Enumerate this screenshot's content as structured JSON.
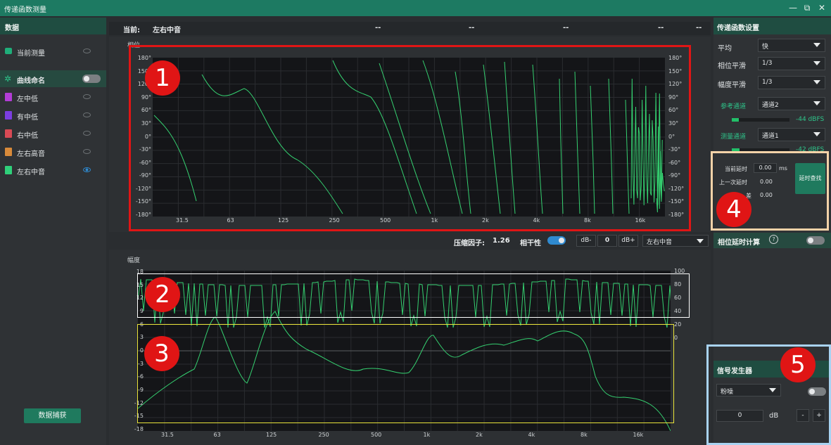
{
  "window": {
    "title": "传递函数测量",
    "controls": {
      "minimize": "—",
      "restore": "⧉",
      "close": "✕"
    }
  },
  "left_panel": {
    "header": "数据",
    "current_measurement": "当前测量",
    "curve_naming": "曲线命名",
    "curve_naming_enabled": false,
    "curves": [
      {
        "name": "左中低",
        "color": "#b33dd6",
        "visible": false
      },
      {
        "name": "有中低",
        "color": "#7b3ee0",
        "visible": false
      },
      {
        "name": "右中低",
        "color": "#d84a55",
        "visible": false
      },
      {
        "name": "左右高音",
        "color": "#d88a3a",
        "visible": false
      },
      {
        "name": "左右中音",
        "color": "#2fd07a",
        "visible": true
      }
    ],
    "capture_button": "数据捕获"
  },
  "current_bar": {
    "label": "当前:",
    "name": "左右中音",
    "values": [
      "--",
      "--",
      "--",
      "--",
      "--"
    ]
  },
  "phase_chart": {
    "section_label": "相位",
    "y_ticks": [
      "180°",
      "150°",
      "120°",
      "90°",
      "60°",
      "30°",
      "0°",
      "-30°",
      "-60°",
      "-90°",
      "-120°",
      "-150°",
      "-180°"
    ],
    "x_ticks": [
      "31.5",
      "63",
      "125",
      "250",
      "500",
      "1k",
      "2k",
      "4k",
      "8k",
      "16k"
    ]
  },
  "mid_bar": {
    "compression_label": "压缩因子:",
    "compression_value": "1.26",
    "coherence_label": "相干性",
    "coherence_enabled": true,
    "db_minus": "dB-",
    "db_value": "0",
    "db_plus": "dB+",
    "curve_select": "左右中音"
  },
  "magnitude_chart": {
    "section_label": "幅度",
    "y_ticks_left": [
      "18",
      "15",
      "12",
      "9",
      "6",
      "3",
      "0",
      "-3",
      "-6",
      "-9",
      "-12",
      "-15",
      "-18"
    ],
    "y_ticks_right": [
      "100",
      "80",
      "60",
      "40",
      "20",
      "0"
    ],
    "x_ticks": [
      "31.5",
      "63",
      "125",
      "250",
      "500",
      "1k",
      "2k",
      "4k",
      "8k",
      "16k"
    ]
  },
  "tf_settings": {
    "header": "传递函数设置",
    "average_label": "平均",
    "average_value": "快",
    "phase_smooth_label": "相位平滑",
    "phase_smooth_value": "1/3",
    "mag_smooth_label": "幅度平滑",
    "mag_smooth_value": "1/3",
    "ref_channel_label": "参考通道",
    "ref_channel_value": "通道2",
    "ref_level": "-44 dBFS",
    "ref_meter_fraction": 0.12,
    "meas_channel_label": "测量通道",
    "meas_channel_value": "通道1",
    "meas_level": "-42 dBFS",
    "meas_meter_fraction": 0.14
  },
  "delay": {
    "current_label": "当前延时",
    "current_value": "0.00",
    "current_unit": "ms",
    "last_label": "上一次延时",
    "last_value": "0.00",
    "third_label": "差",
    "third_value": "0.00",
    "find_button": "延时查找",
    "phase_delay_label": "相位延时计算",
    "phase_delay_help": "?",
    "phase_delay_enabled": false
  },
  "signal_generator": {
    "header": "信号发生器",
    "type": "粉噪",
    "enabled": false,
    "level": "0",
    "unit": "dB",
    "minus": "-",
    "plus": "+"
  },
  "annotations": {
    "labels": [
      "1",
      "2",
      "3",
      "4",
      "5"
    ],
    "box1_color": "#e01515",
    "box2_color": "#ffffff",
    "box3_color": "#e8e23a",
    "box4_color": "#f3d2a8",
    "box5_color": "#a9d3f2"
  },
  "colors": {
    "accent": "#1d7a62",
    "trace": "#35d070",
    "toggle_on": "#2f8ad0"
  }
}
